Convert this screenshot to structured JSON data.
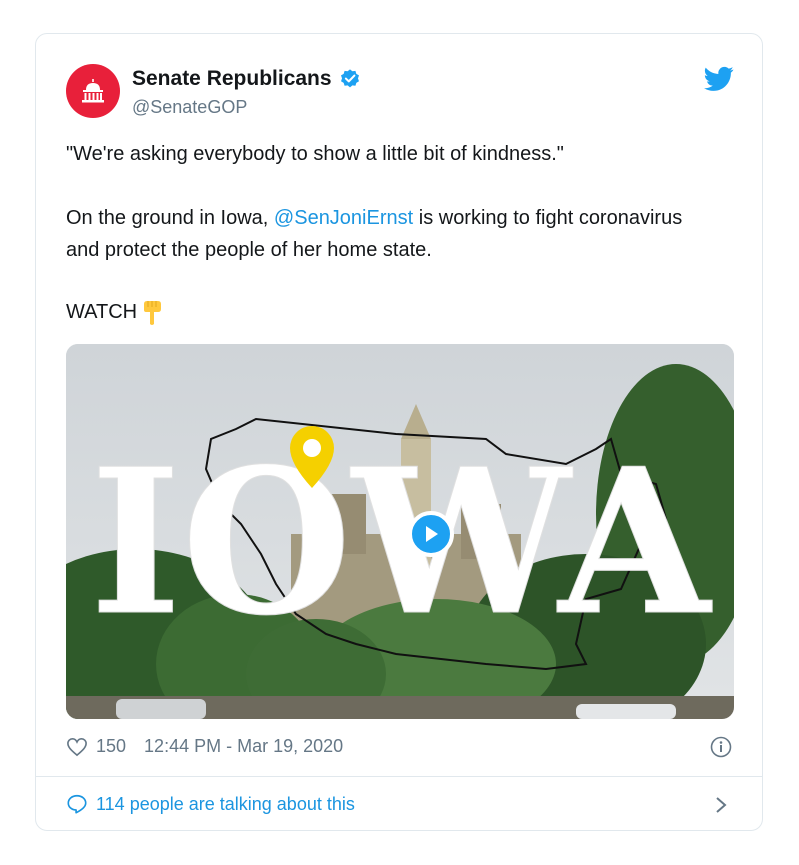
{
  "tweet": {
    "author_name": "Senate Republicans",
    "author_handle": "@SenateGOP",
    "line1": "\"We're asking everybody to show a little bit of kindness.\"",
    "line2_before": "On the ground in Iowa, ",
    "mention": "@SenJoniErnst",
    "line2_after": " is working to fight coronavirus and protect the people of her home state.",
    "watch": "WATCH",
    "media_overlay_text": "IOWA",
    "likes": "150",
    "timestamp": "12:44 PM - Mar 19, 2020",
    "talking": "114 people are talking about this"
  },
  "icons": [
    "capitol-icon",
    "verified-badge-icon",
    "twitter-bird-icon",
    "pointing-down-emoji",
    "play-icon",
    "map-pin-icon",
    "heart-icon",
    "info-icon",
    "speech-bubble-icon",
    "chevron-right-icon"
  ],
  "colors": {
    "accent": "#1da1f2",
    "link": "#1b95e0",
    "avatar_bg": "#e8203a",
    "secondary_text": "#657786",
    "pin": "#f5d000"
  }
}
